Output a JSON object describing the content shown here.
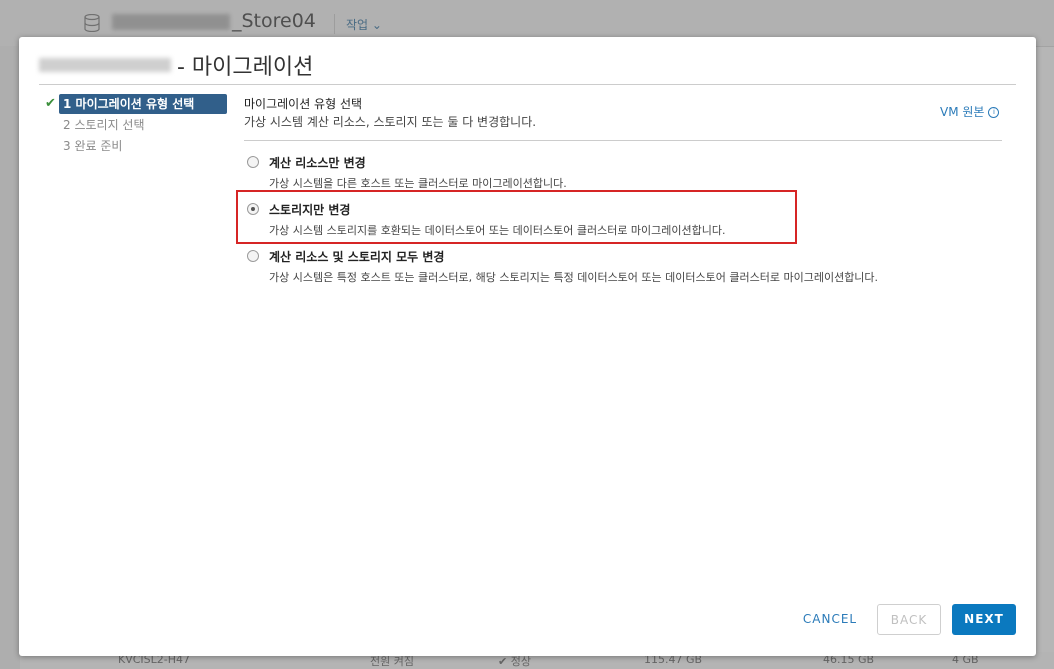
{
  "background": {
    "title_suffix": "_Store04",
    "actions_label": "작업 ⌄",
    "bottom_row": {
      "vm_name": "KVCISL2-H47",
      "state": "전원 켜짐",
      "status": "✔ 정상",
      "size1": "115.47 GB",
      "size2": "46.15 GB",
      "memory": "4 GB"
    }
  },
  "modal": {
    "title": "- 마이그레이션",
    "steps": [
      {
        "label": "1 마이그레이션 유형 선택",
        "done": true
      },
      {
        "label": "2 스토리지 선택"
      },
      {
        "label": "3 완료 준비"
      }
    ],
    "section_title": "마이그레이션 유형 선택",
    "section_subtitle": "가상 시스템 계산 리소스, 스토리지 또는 둘 다 변경합니다.",
    "vm_origin_link": "VM 원본",
    "options": [
      {
        "label": "계산 리소스만 변경",
        "description": "가상 시스템을 다른 호스트 또는 클러스터로 마이그레이션합니다.",
        "selected": false
      },
      {
        "label": "스토리지만 변경",
        "description": "가상 시스템 스토리지를 호환되는 데이터스토어 또는 데이터스토어 클러스터로 마이그레이션합니다.",
        "selected": true
      },
      {
        "label": "계산 리소스 및 스토리지 모두 변경",
        "description": "가상 시스템은 특정 호스트 또는 클러스터로, 해당 스토리지는 특정 데이터스토어 또는 데이터스토어 클러스터로 마이그레이션합니다.",
        "selected": false
      }
    ],
    "buttons": {
      "cancel": "CANCEL",
      "back": "BACK",
      "next": "NEXT"
    }
  }
}
